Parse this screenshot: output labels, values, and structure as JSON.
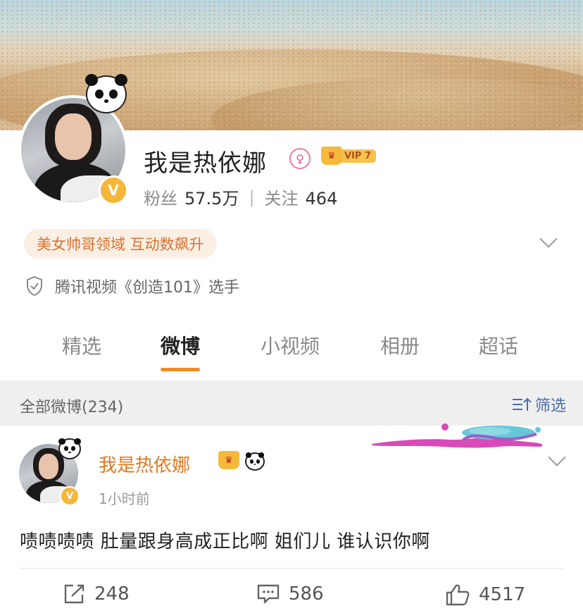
{
  "profile": {
    "name": "我是热依娜",
    "gender_icon": "female-icon",
    "vip_label": "VIP 7",
    "verified_badge": "V",
    "fans_label": "粉丝",
    "fans_count": "57.5万",
    "following_label": "关注",
    "following_count": "464",
    "tag": "美女帅哥领域 互动数飙升",
    "certification": "腾讯视频《创造101》选手"
  },
  "tabs": [
    {
      "label": "精选",
      "active": false
    },
    {
      "label": "微博",
      "active": true
    },
    {
      "label": "小视频",
      "active": false
    },
    {
      "label": "相册",
      "active": false
    },
    {
      "label": "超话",
      "active": false
    }
  ],
  "filter": {
    "title": "全部微博(234)",
    "button_label": "筛选"
  },
  "post": {
    "author": "我是热依娜",
    "time": "1小时前",
    "text": "啧啧啧啧 肚量跟身高成正比啊 姐们儿 谁认识你啊",
    "reposts": "248",
    "comments": "586",
    "likes": "4517"
  },
  "colors": {
    "accent_orange": "#f08a24",
    "name_orange": "#e07a22",
    "link_blue": "#4a6da6",
    "badge_gold": "#f4b73a"
  }
}
